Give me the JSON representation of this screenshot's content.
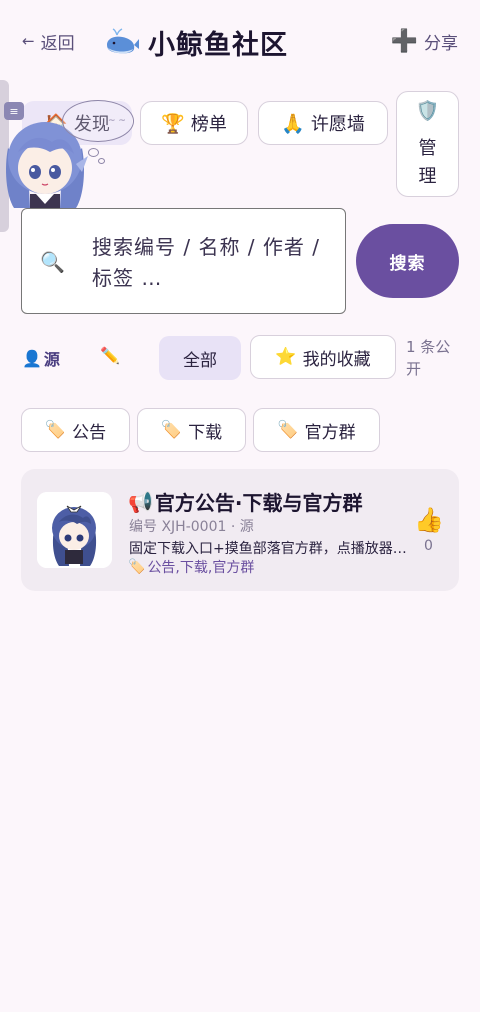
{
  "header": {
    "back_arrow": "←",
    "back_label": "返回",
    "title": "小鲸鱼社区",
    "share_plus": "➕",
    "share_label": "分享"
  },
  "tabs": [
    {
      "icon": "🏠",
      "label": "发现",
      "active": true
    },
    {
      "icon": "🏆",
      "label": "榜单",
      "active": false
    },
    {
      "icon": "🙏",
      "label": "许愿墙",
      "active": false
    },
    {
      "icon": "🛡️",
      "label": "管理",
      "label_lines": [
        "管",
        "理"
      ],
      "active": false
    }
  ],
  "side_button_glyph": "≡",
  "bubble_text": "~ ~",
  "search": {
    "icon": "🔍",
    "placeholder": "搜索编号 / 名称 / 作者 / 标签 …",
    "button_label": "搜索"
  },
  "filter": {
    "user_icon": "👤",
    "source_label": "源",
    "edit_icon": "✏️",
    "all_label": "全部",
    "fav_icon": "⭐",
    "fav_label": "我的收藏",
    "count_text": "1 条公开"
  },
  "tags": [
    {
      "icon": "🏷️",
      "label": "公告"
    },
    {
      "icon": "🏷️",
      "label": "下载"
    },
    {
      "icon": "🏷️",
      "label": "官方群"
    }
  ],
  "items": [
    {
      "title_icon": "📢",
      "title": "官方公告·下载与官方群",
      "meta": "编号 XJH-0001 · 源",
      "description": "固定下载入口+摸鱼部落官方群，点播放器…",
      "tags_icon": "🏷️",
      "tags": "公告,下载,官方群",
      "like_icon": "👍",
      "likes": "0"
    }
  ],
  "colors": {
    "background": "#fcf6fb",
    "accent": "#6a4fa0",
    "active_tab": "#ece6f7",
    "card": "#f1ebf2"
  }
}
